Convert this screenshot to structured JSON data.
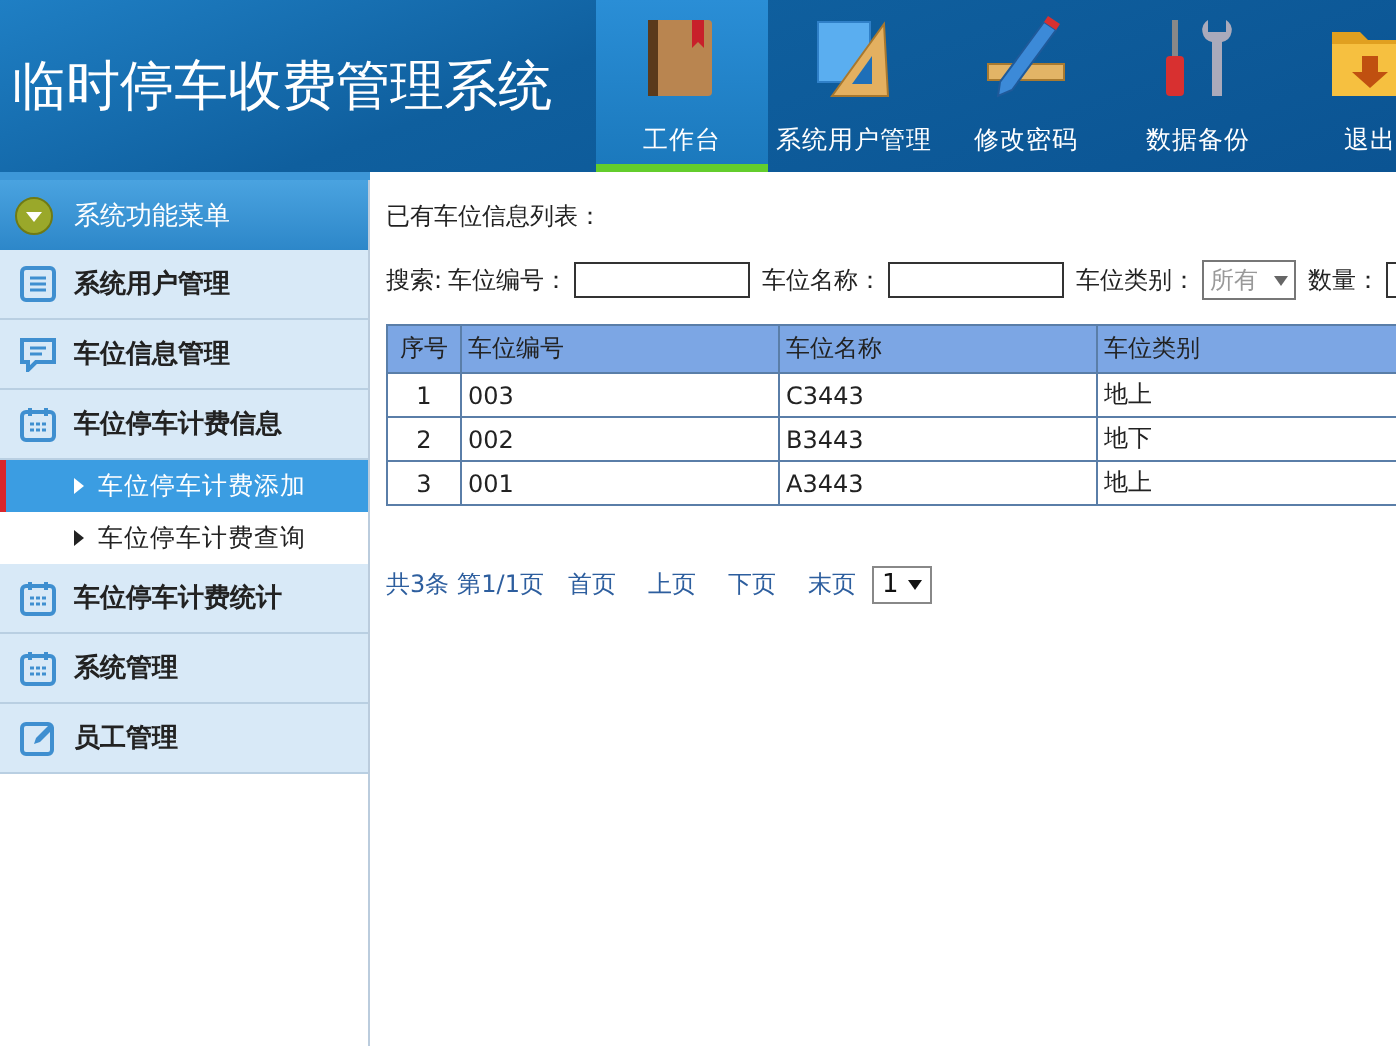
{
  "header": {
    "title": "临时停车收费管理系统",
    "nav": [
      {
        "label": "工作台",
        "selected": true
      },
      {
        "label": "系统用户管理",
        "selected": false
      },
      {
        "label": "修改密码",
        "selected": false
      },
      {
        "label": "数据备份",
        "selected": false
      },
      {
        "label": "退出",
        "selected": false
      }
    ]
  },
  "sidebar": {
    "title": "系统功能菜单",
    "items": [
      {
        "label": "系统用户管理",
        "kind": "list"
      },
      {
        "label": "车位信息管理",
        "kind": "chat"
      },
      {
        "label": "车位停车计费信息",
        "kind": "calendar",
        "children": [
          {
            "label": "车位停车计费添加",
            "selected": true
          },
          {
            "label": "车位停车计费查询",
            "selected": false
          }
        ]
      },
      {
        "label": "车位停车计费统计",
        "kind": "calendar"
      },
      {
        "label": "系统管理",
        "kind": "calendar"
      },
      {
        "label": "员工管理",
        "kind": "edit"
      }
    ]
  },
  "main": {
    "list_title": "已有车位信息列表：",
    "search": {
      "label": "搜索:",
      "fields": [
        {
          "label": "车位编号：",
          "kind": "text"
        },
        {
          "label": "车位名称：",
          "kind": "text"
        },
        {
          "label": "车位类别：",
          "kind": "select",
          "value": "所有"
        },
        {
          "label": "数量：",
          "kind": "text"
        }
      ]
    },
    "table": {
      "columns": [
        "序号",
        "车位编号",
        "车位名称",
        "车位类别"
      ],
      "rows": [
        [
          "1",
          "003",
          "C3443",
          "地上"
        ],
        [
          "2",
          "002",
          "B3443",
          "地下"
        ],
        [
          "3",
          "001",
          "A3443",
          "地上"
        ]
      ]
    },
    "pagination": {
      "total": "共3条",
      "page": "第1/1页",
      "links": [
        "首页",
        "上页",
        "下页",
        "末页"
      ],
      "page_select": "1"
    }
  }
}
